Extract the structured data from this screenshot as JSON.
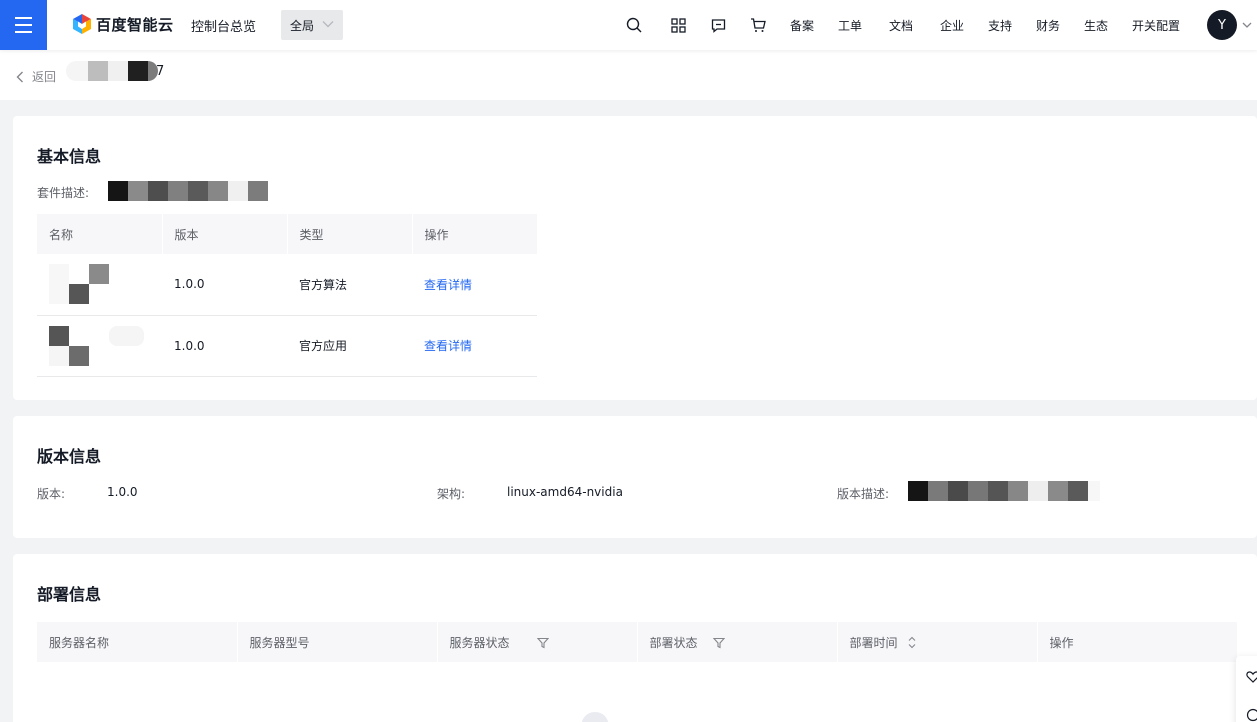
{
  "header": {
    "brand": "百度智能云",
    "console": "控制台总览",
    "region": "全局",
    "nav": [
      "备案",
      "工单",
      "文档",
      "企业",
      "支持",
      "财务",
      "生态",
      "开关配置"
    ],
    "avatar_letter": "Y",
    "colors": {
      "accent": "#2468f2",
      "menu_bg": "#2468f2"
    }
  },
  "back": {
    "label": "返回",
    "title_suffix": "7"
  },
  "basic": {
    "title": "基本信息",
    "desc_label": "套件描述:",
    "table": {
      "headers": [
        "名称",
        "版本",
        "类型",
        "操作"
      ],
      "rows": [
        {
          "version": "1.0.0",
          "type": "官方算法",
          "action": "查看详情"
        },
        {
          "version": "1.0.0",
          "type": "官方应用",
          "action": "查看详情"
        }
      ]
    }
  },
  "version": {
    "title": "版本信息",
    "version_label": "版本:",
    "version_value": "1.0.0",
    "arch_label": "架构:",
    "arch_value": "linux-amd64-nvidia",
    "desc_label": "版本描述:"
  },
  "deploy": {
    "title": "部署信息",
    "headers": [
      "服务器名称",
      "服务器型号",
      "服务器状态",
      "部署状态",
      "部署时间",
      "操作"
    ]
  },
  "icons": [
    "menu-icon",
    "search-icon",
    "grid-icon",
    "message-icon",
    "cart-icon",
    "chevron-down-icon",
    "chevron-left-icon",
    "filter-icon",
    "sort-icon",
    "heart-icon"
  ]
}
